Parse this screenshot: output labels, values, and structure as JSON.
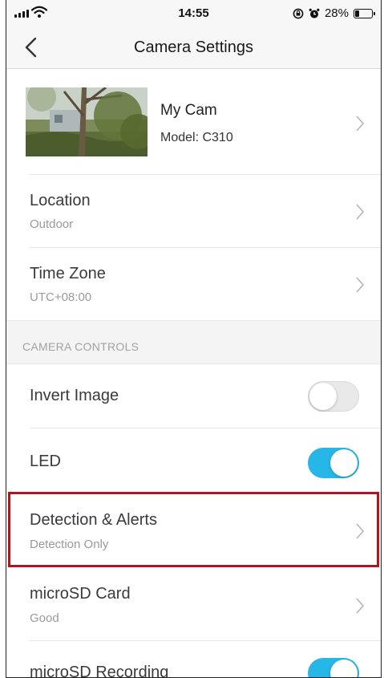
{
  "status_bar": {
    "time": "14:55",
    "battery_text": "28%",
    "battery_level": 0.28,
    "lock_rotation_icon": "rotation-lock-icon",
    "alarm_icon": "alarm-clock-icon"
  },
  "nav": {
    "title": "Camera Settings",
    "back_icon": "chevron-left-icon"
  },
  "camera": {
    "name": "My Cam",
    "model": "Model: C310"
  },
  "rows": {
    "location": {
      "label": "Location",
      "value": "Outdoor"
    },
    "timezone": {
      "label": "Time Zone",
      "value": "UTC+08:00"
    }
  },
  "section": {
    "camera_controls": "CAMERA CONTROLS"
  },
  "controls": {
    "invert_image": {
      "label": "Invert Image",
      "enabled": false
    },
    "led": {
      "label": "LED",
      "enabled": true
    },
    "detection": {
      "label": "Detection & Alerts",
      "value": "Detection Only"
    },
    "microsd_card": {
      "label": "microSD Card",
      "value": "Good"
    },
    "microsd_recording": {
      "label": "microSD Recording",
      "enabled": true
    }
  },
  "colors": {
    "toggle_on": "#27b6e8",
    "toggle_off": "#e9e9e9",
    "highlight": "#b3141d"
  }
}
